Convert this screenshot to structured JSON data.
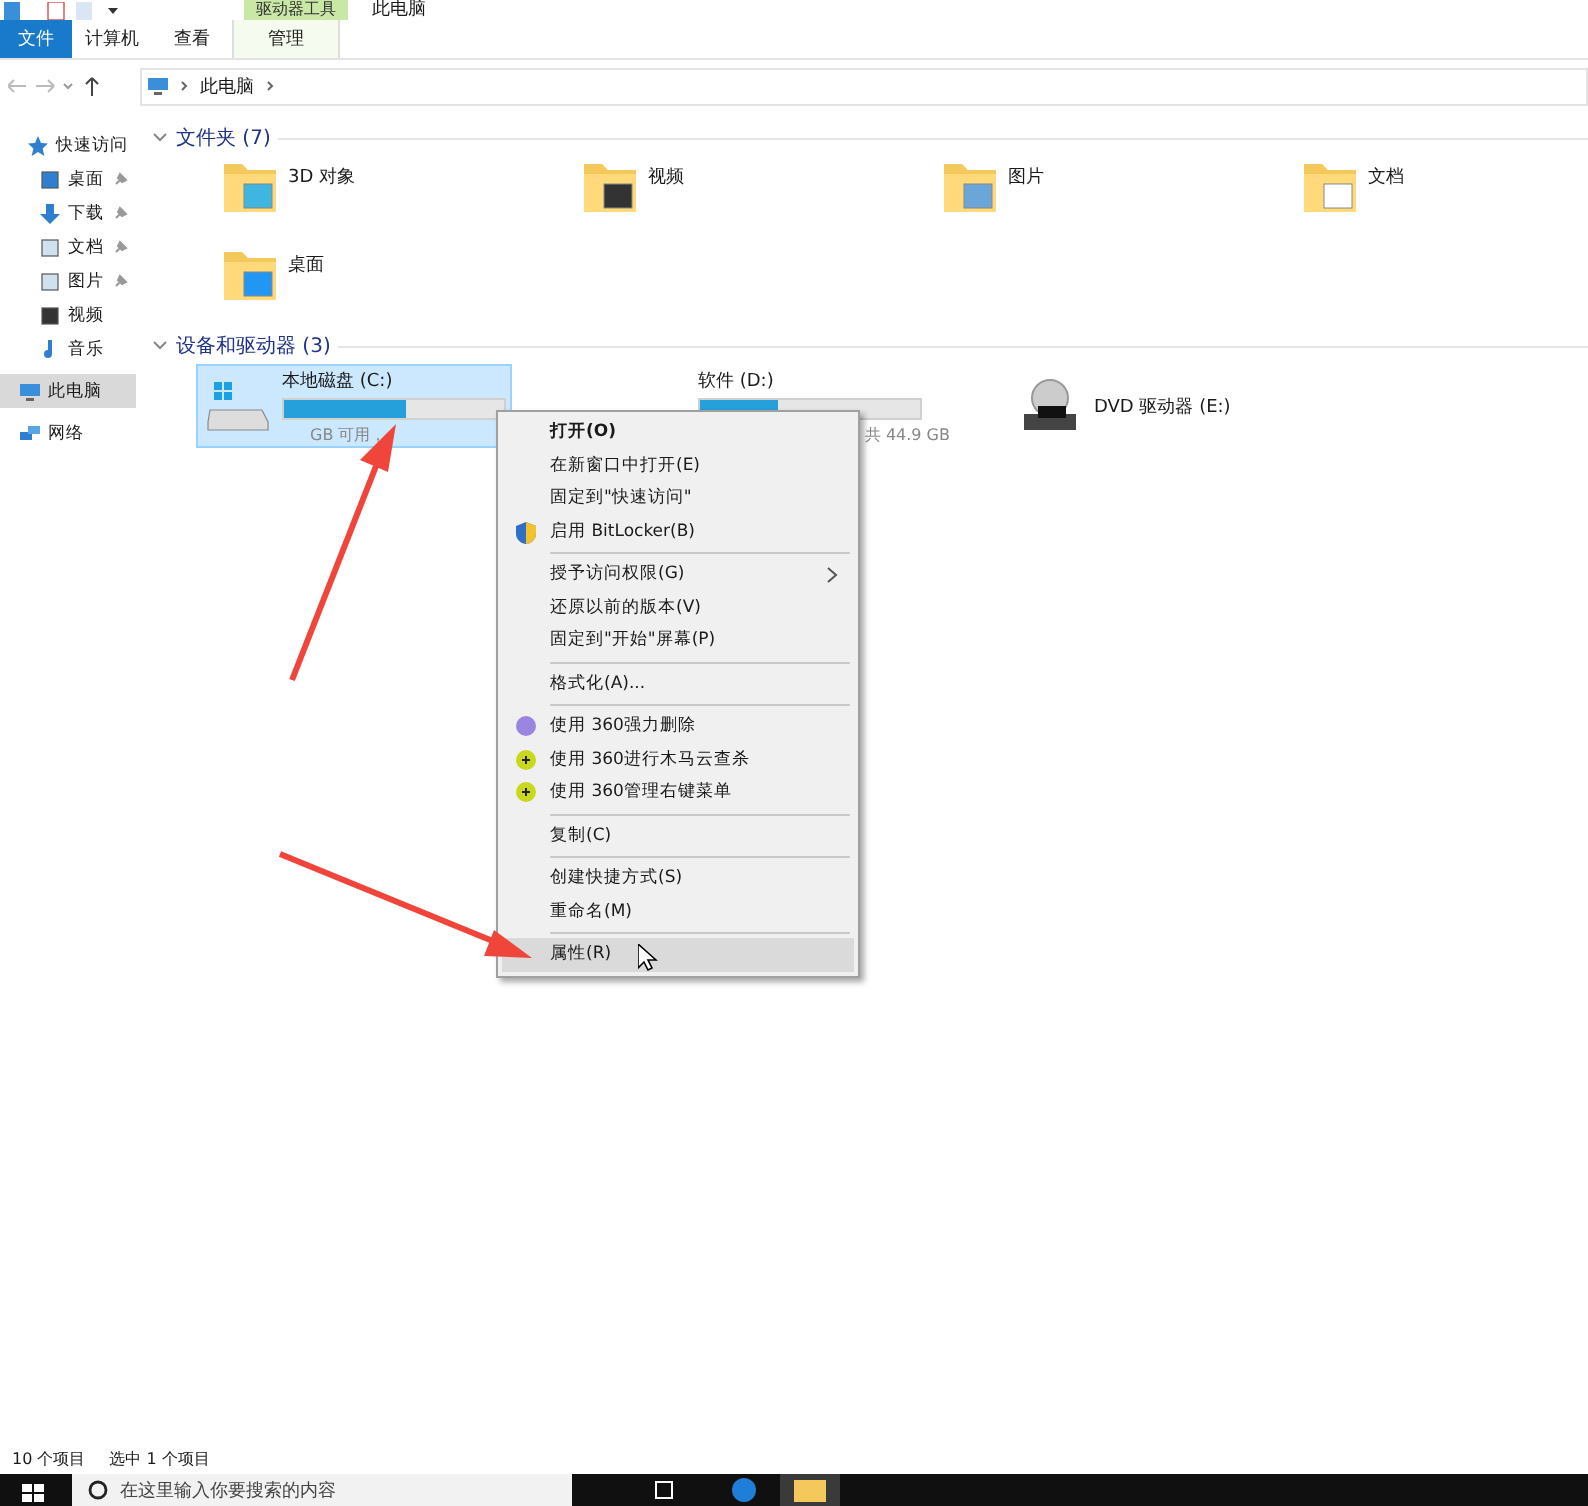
{
  "window": {
    "title": "此电脑",
    "tool_group": "驱动器工具"
  },
  "tabs": [
    {
      "label": "文件",
      "kind": "file"
    },
    {
      "label": "计算机",
      "kind": "tab"
    },
    {
      "label": "查看",
      "kind": "tab"
    },
    {
      "label": "管理",
      "kind": "tool"
    }
  ],
  "address": {
    "path": "此电脑"
  },
  "sidebar": {
    "items": [
      {
        "label": "快速访问",
        "selected": false,
        "children": [
          {
            "label": "桌面",
            "pinned": true
          },
          {
            "label": "下载",
            "pinned": true
          },
          {
            "label": "文档",
            "pinned": true
          },
          {
            "label": "图片",
            "pinned": true
          },
          {
            "label": "视频",
            "pinned": false
          },
          {
            "label": "音乐",
            "pinned": false
          }
        ]
      },
      {
        "label": "此电脑",
        "selected": true
      },
      {
        "label": "网络",
        "selected": false
      }
    ]
  },
  "folders": {
    "title": "文件夹 (7)",
    "items": [
      {
        "name": "3D 对象"
      },
      {
        "name": "视频"
      },
      {
        "name": "图片"
      },
      {
        "name": "文档"
      },
      {
        "name": "桌面"
      }
    ]
  },
  "drives": {
    "title": "设备和驱动器 (3)",
    "items": [
      {
        "name": "本地磁盘 (C:)",
        "kind": "disk",
        "selected": true,
        "level": 0.55,
        "space": "GB 可用，"
      },
      {
        "name": "软件 (D:)",
        "kind": "disk",
        "selected": false,
        "level": 0.35,
        "space": "共 44.9 GB"
      },
      {
        "name": "DVD 驱动器 (E:)",
        "kind": "dvd",
        "selected": false
      }
    ]
  },
  "context_menu": {
    "items": [
      {
        "kind": "item",
        "label": "打开(O)",
        "bold": true,
        "selected": false
      },
      {
        "kind": "item",
        "label": "在新窗口中打开(E)",
        "bold": false,
        "selected": false
      },
      {
        "kind": "item",
        "label": "固定到\"快速访问\"",
        "bold": false,
        "selected": false
      },
      {
        "kind": "shield",
        "label": "启用 BitLocker(B)",
        "bold": false,
        "selected": false
      },
      {
        "kind": "separator"
      },
      {
        "kind": "submenu",
        "label": "授予访问权限(G)",
        "bold": false,
        "selected": false
      },
      {
        "kind": "item",
        "label": "还原以前的版本(V)",
        "bold": false,
        "selected": false
      },
      {
        "kind": "item",
        "label": "固定到\"开始\"屏幕(P)",
        "bold": false,
        "selected": false
      },
      {
        "kind": "separator"
      },
      {
        "kind": "item",
        "label": "格式化(A)...",
        "bold": false,
        "selected": false
      },
      {
        "kind": "separator"
      },
      {
        "kind": "shredder",
        "label": "使用 360强力删除",
        "bold": false,
        "selected": false
      },
      {
        "kind": "scan",
        "label": "使用 360进行木马云查杀",
        "bold": false,
        "selected": false
      },
      {
        "kind": "scan",
        "label": "使用 360管理右键菜单",
        "bold": false,
        "selected": false
      },
      {
        "kind": "separator"
      },
      {
        "kind": "item",
        "label": "复制(C)",
        "bold": false,
        "selected": false
      },
      {
        "kind": "separator"
      },
      {
        "kind": "item",
        "label": "创建快捷方式(S)",
        "bold": false,
        "selected": false
      },
      {
        "kind": "item",
        "label": "重命名(M)",
        "bold": false,
        "selected": false
      },
      {
        "kind": "separator"
      },
      {
        "kind": "item",
        "label": "属性(R)",
        "bold": false,
        "selected": true
      }
    ]
  },
  "status_bar": {
    "count": "10 个项目",
    "selection": "选中 1 个项目"
  },
  "taskbar": {
    "search_placeholder": "在这里输入你要搜索的内容"
  }
}
